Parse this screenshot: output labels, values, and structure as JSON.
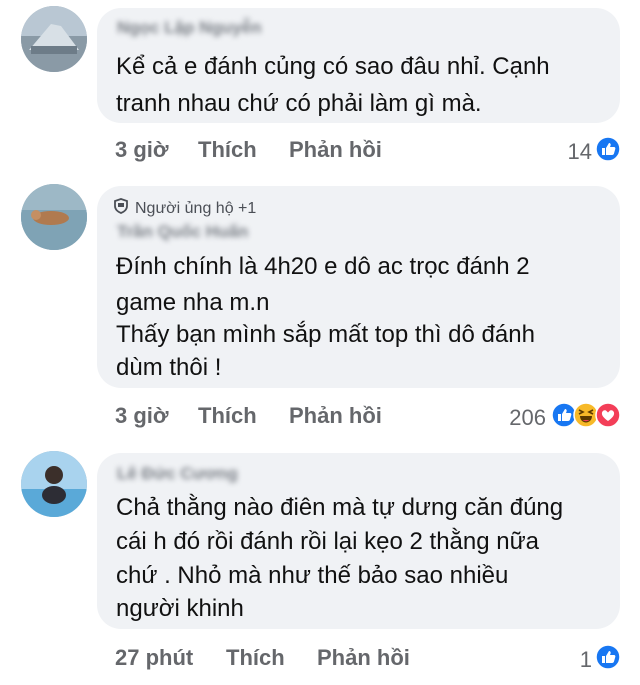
{
  "comments": [
    {
      "author": "Ngọc Lập Nguyễn",
      "badge": "",
      "text_lines": [
        "Kể cả e đánh củng có sao đâu nhỉ. Cạnh",
        "tranh nhau chứ có phải làm gì mà."
      ],
      "time": "3 giờ",
      "like_label": "Thích",
      "reply_label": "Phản hồi",
      "reaction_count": "14",
      "reactions": [
        "like-icon"
      ]
    },
    {
      "author": "Trần Quốc Huấn",
      "badge": "Người ủng hộ +1",
      "text_lines": [
        "Đính chính là 4h20 e dô ac trọc đánh 2",
        "game nha m.n",
        "Thấy bạn mình sắp mất top thì dô đánh",
        "dùm thôi !"
      ],
      "time": "3 giờ",
      "like_label": "Thích",
      "reply_label": "Phản hồi",
      "reaction_count": "206",
      "reactions": [
        "like-icon",
        "haha-icon",
        "love-icon"
      ]
    },
    {
      "author": "Lê Đức Cương",
      "badge": "",
      "text_lines": [
        "Chả thằng nào điên mà tự dưng căn đúng",
        "cái h đó rồi đánh rồi lại kẹo 2 thằng nữa",
        "chứ . Nhỏ mà như thế bảo sao nhiều",
        "người khinh"
      ],
      "time": "27 phút",
      "like_label": "Thích",
      "reply_label": "Phản hồi",
      "reaction_count": "1",
      "reactions": [
        "like-icon"
      ]
    }
  ],
  "colors": {
    "bubble": "#f0f2f5",
    "action_text": "#65676b",
    "like_blue": "#1877f2",
    "haha_yellow": "#f7b928",
    "love_red": "#f33e58"
  }
}
